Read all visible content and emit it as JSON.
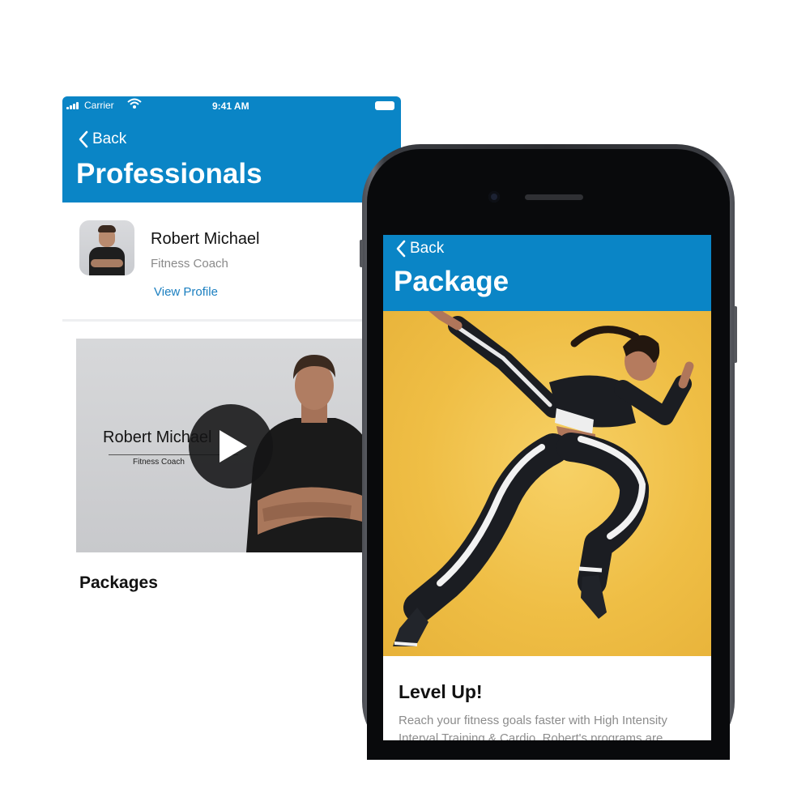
{
  "back_screen": {
    "status_bar": {
      "carrier": "Carrier",
      "time": "9:41 AM"
    },
    "nav": {
      "back_label": "Back",
      "title": "Professionals"
    },
    "professional": {
      "name": "Robert Michael",
      "role": "Fitness Coach",
      "view_profile_label": "View Profile"
    },
    "video": {
      "overlay_name": "Robert Michael",
      "overlay_role": "Fitness Coach"
    },
    "packages_heading": "Packages"
  },
  "front_screen": {
    "nav": {
      "back_label": "Back",
      "title": "Package"
    },
    "package": {
      "name": "Level Up!",
      "description": "Reach your fitness goals faster with High Intensity Interval Training & Cardio. Robert's programs are"
    }
  },
  "colors": {
    "header_blue": "#0a85c6",
    "link_blue": "#1b7fc0",
    "hero_yellow": "#efbe45"
  },
  "icons": [
    "signal-icon",
    "wifi-icon",
    "battery-icon",
    "chevron-left-icon",
    "play-icon"
  ]
}
